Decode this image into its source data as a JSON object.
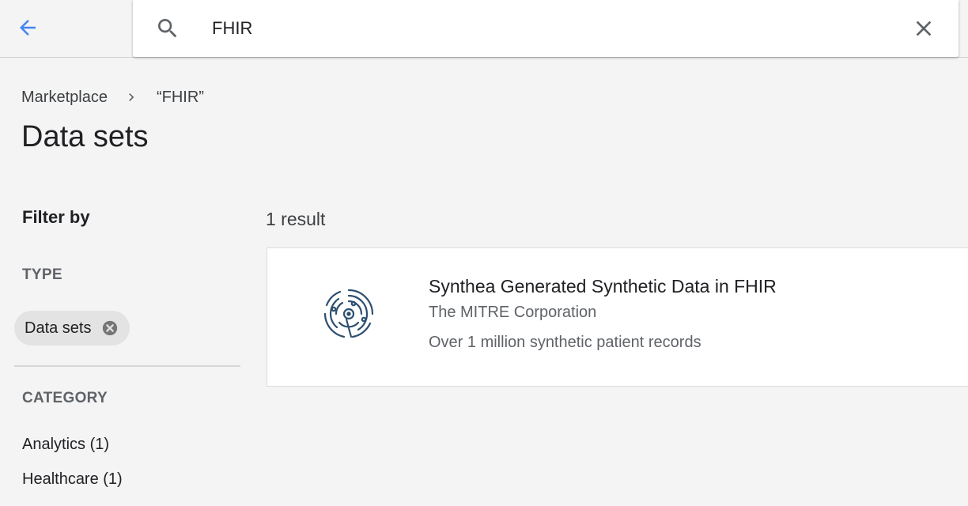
{
  "search": {
    "value": "FHIR",
    "placeholder": ""
  },
  "breadcrumb": {
    "root": "Marketplace",
    "current": "“FHIR”"
  },
  "page_title": "Data sets",
  "filters": {
    "title": "Filter by",
    "type_label": "TYPE",
    "type_chip": "Data sets",
    "category_label": "CATEGORY",
    "categories": [
      {
        "label": "Analytics (1)"
      },
      {
        "label": "Healthcare (1)"
      }
    ]
  },
  "results": {
    "count_text": "1 result",
    "items": [
      {
        "title": "Synthea Generated Synthetic Data in FHIR",
        "provider": "The MITRE Corporation",
        "description": "Over 1 million synthetic patient records",
        "logo_icon": "synthea-logo-icon"
      }
    ]
  },
  "colors": {
    "accent": "#4285f4",
    "logo": "#2f4f6f",
    "background": "#f4f4f4"
  }
}
